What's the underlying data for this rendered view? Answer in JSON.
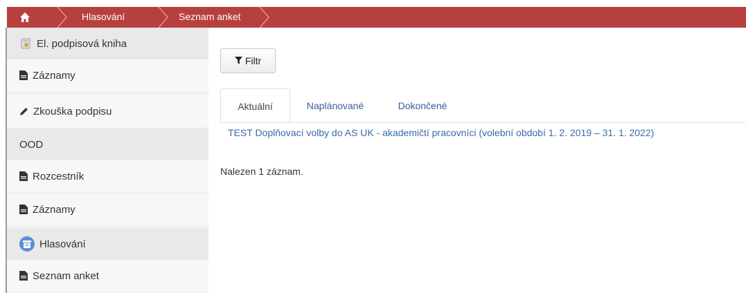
{
  "breadcrumb": {
    "home_icon": "home-icon",
    "items": [
      "Hlasování",
      "Seznam anket"
    ],
    "bg_color": "#b7403f"
  },
  "sidebar": {
    "items": [
      {
        "label": "El. podpisová kniha",
        "icon": "signature-book-icon",
        "kind": "header"
      },
      {
        "label": "Záznamy",
        "icon": "document-icon",
        "kind": "sub"
      },
      {
        "label": "Zkouška podpisu",
        "icon": "pencil-icon",
        "kind": "sub"
      },
      {
        "label": "OOD",
        "icon": "",
        "kind": "header"
      },
      {
        "label": "Rozcestník",
        "icon": "document-icon",
        "kind": "sub"
      },
      {
        "label": "Záznamy",
        "icon": "document-icon",
        "kind": "sub"
      },
      {
        "label": "Hlasování",
        "icon": "ballot-box-icon",
        "kind": "header"
      },
      {
        "label": "Seznam anket",
        "icon": "document-icon",
        "kind": "sub"
      }
    ]
  },
  "main": {
    "filter_label": "Filtr",
    "tabs": [
      {
        "label": "Aktuální",
        "active": true
      },
      {
        "label": "Naplánované",
        "active": false
      },
      {
        "label": "Dokončené",
        "active": false
      }
    ],
    "survey_link": "TEST Doplňovací volby do AS UK - akademičtí pracovníci (volební období 1. 2. 2019 – 31. 1. 2022)",
    "result_count": "Nalezen 1 záznam.",
    "link_color": "#3a6aa8"
  }
}
